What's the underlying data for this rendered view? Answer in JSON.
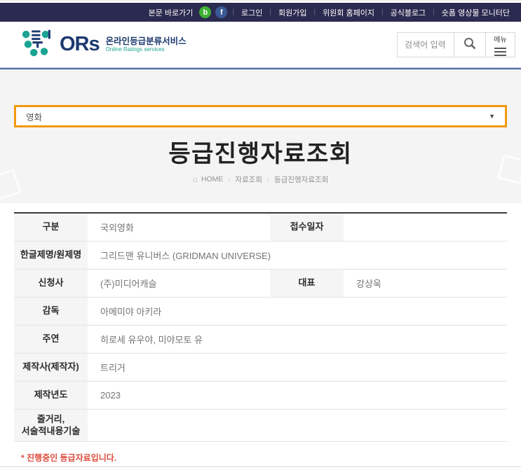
{
  "topbar": {
    "skip_link": "본문 바로가기",
    "blog_icon_letter": "b",
    "facebook_icon_letter": "f",
    "links": [
      "로그인",
      "회원가입",
      "위원회 홈페이지",
      "공식블로그",
      "숏폼 영상물 모니터단"
    ]
  },
  "header": {
    "logo": {
      "ors": "ORs",
      "service_kr": "온라인등급분류서비스",
      "service_en": "Online Ratings services"
    },
    "search_placeholder": "검색어 입력",
    "menu_label": "메뉴"
  },
  "filter": {
    "selected": "영화"
  },
  "page": {
    "title": "등급진행자료조회",
    "breadcrumb": [
      "HOME",
      "자료조회",
      "등급진행자료조회"
    ]
  },
  "table": {
    "rows": [
      {
        "label": "구분",
        "value": "국외영화",
        "label2": "접수일자",
        "value2": ""
      },
      {
        "label": "한글제명/원제명",
        "value": "그리드맨 유니버스  (GRIDMAN UNIVERSE)"
      },
      {
        "label": "신청사",
        "value": "(주)미디어캐슬",
        "label2": "대표",
        "value2": "강상욱"
      },
      {
        "label": "감독",
        "value": "아메미야 아키라"
      },
      {
        "label": "주연",
        "value": "히로세 유우야, 미야모토 유"
      },
      {
        "label": "제작사(제작자)",
        "value": "트리거"
      },
      {
        "label": "제작년도",
        "value": "2023"
      },
      {
        "label_line1": "줄거리,",
        "label_line2": "서술적내용기술",
        "value": ""
      }
    ]
  },
  "note": {
    "text": "* 진행중인 등급자료입니다."
  },
  "colors": {
    "navy_bar": "#2B2A50",
    "logo_navy": "#1D3A70",
    "logo_teal": "#1BA393",
    "header_rule_blue": "#54719E",
    "highlight_orange": "#F2990F",
    "band_gray": "#F4F4F4",
    "label_bg": "#F5F5F5",
    "note_red": "#DC4B3C"
  }
}
